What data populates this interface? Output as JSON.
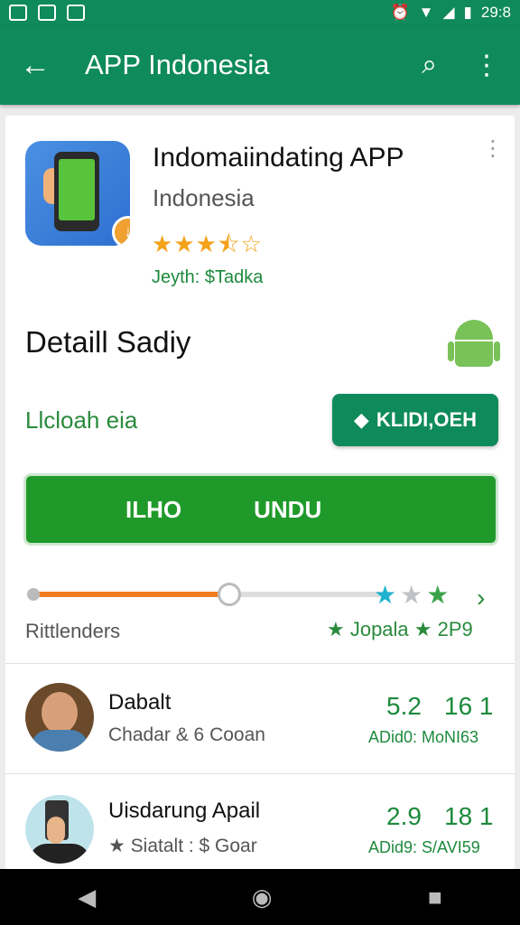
{
  "status_bar": {
    "time": "29:8",
    "icons": [
      "gallery-icon",
      "drive-icon",
      "photo-icon",
      "alarm-icon",
      "wifi-icon",
      "signal-icon",
      "battery-icon"
    ]
  },
  "toolbar": {
    "title": "APP Indonesia",
    "back_icon": "back-arrow-icon",
    "search_icon": "search-icon",
    "menu_icon": "overflow-menu-icon"
  },
  "app": {
    "name": "Indomaiindating APP",
    "subtitle": "Indonesia",
    "rating": 3.5,
    "stars_text": "★★★⯪☆",
    "meta": "Jeyth: $Tadka"
  },
  "section": {
    "title": "Detaill Sadiy",
    "link_text": "Llcloah eia",
    "small_button_label": "KLIDI,OEH",
    "big_button_left": "ΙLΗΟ",
    "big_button_right": "UNDU"
  },
  "ratings": {
    "progress": 0.55,
    "label": "Rittlenders",
    "right_text": "★ Jopala ★ 2P9"
  },
  "reviews": [
    {
      "name": "Dabalt",
      "sub": "Chadar & 6 Cooan",
      "score1": "5.2",
      "score2": "16 1",
      "meta": "ADid0: MoNI63"
    },
    {
      "name": "Uisdarung Apail",
      "sub": "★ Siatalt : $ Goar",
      "score1": "2.9",
      "score2": "18 1",
      "meta": "ADid9: S/AVI59"
    }
  ],
  "colors": {
    "primary": "#0f8a5a",
    "button_green": "#1f9a2a",
    "accent_orange": "#f07d22",
    "star_gold": "#f3a21a"
  }
}
